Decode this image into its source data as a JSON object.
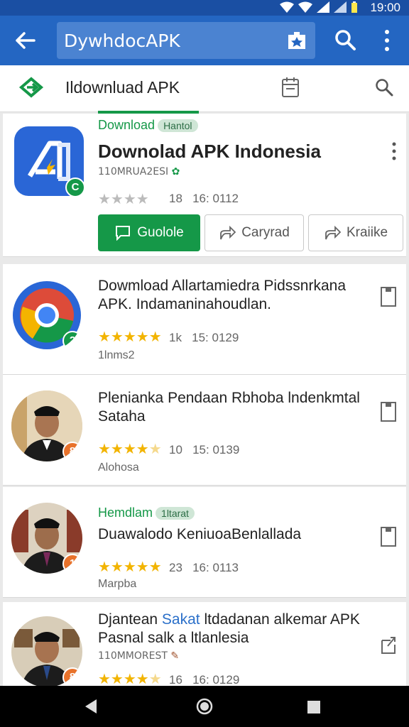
{
  "status_bar": {
    "time": "19:00"
  },
  "app_bar": {
    "search_query": "DywhdocAPK"
  },
  "sub_bar": {
    "title": "Ildownluad APK"
  },
  "featured": {
    "tag": "Download",
    "tag_badge": "Hantol",
    "title": "Downolad APK Indonesia",
    "meta": "110MRUA2ESI",
    "rating_count": "18",
    "rating_value": "16: 0112",
    "badge": "C",
    "buttons": {
      "primary": "Guolole",
      "second": "Caryrad",
      "third": "Kraiike"
    }
  },
  "rows": [
    {
      "title": "Dowmload Allartamiedra Pidssnrkana APK. Indamaninahoudlan.",
      "rating_count": "1k",
      "rating_value": "15: 0129",
      "sub": "1lnms2",
      "badge": "2"
    },
    {
      "title": "Plenianka Pendaan Rbhoba lndenkmtal Sataha",
      "rating_count": "10",
      "rating_value": "15: 0139",
      "sub": "Alohosa",
      "badge": "8"
    },
    {
      "tag": "Hemdlam",
      "tag_badge": "1ltarat",
      "title": "Duawalodo KeniuoaBenlallada",
      "rating_count": "23",
      "rating_value": "16: 0113",
      "sub": "Marpba",
      "badge": "1"
    },
    {
      "title_a": "Djantean",
      "title_link": "Sakat",
      "title_b": "ltdadanan alkemar APK Pasnal salk a ltlanlesia",
      "meta": "110MMOREST",
      "rating_count": "16",
      "rating_value": "16: 0129",
      "badge": "8"
    }
  ]
}
